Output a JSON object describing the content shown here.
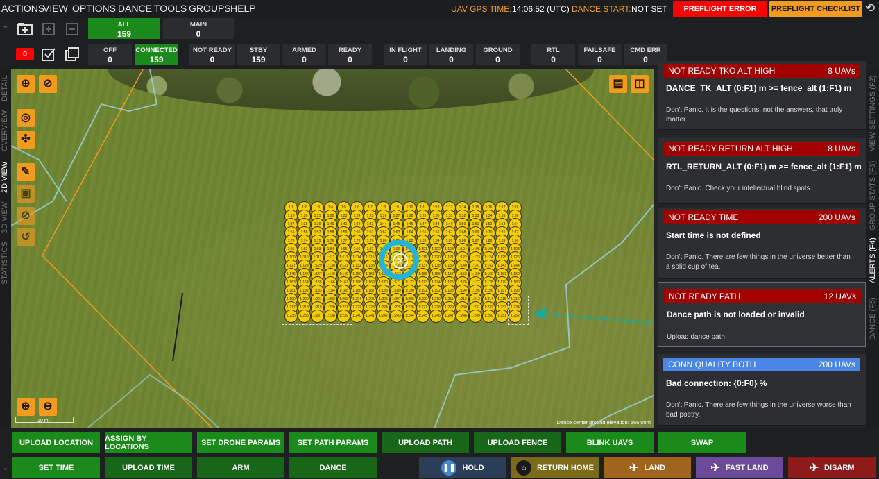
{
  "menu": [
    "ACTIONS",
    "VIEW",
    "OPTIONS",
    "DANCE",
    "TOOLS",
    "GROUPS",
    "HELP"
  ],
  "header": {
    "gps_label": "UAV GPS TIME:",
    "gps_value": "14:06:52 (UTC)",
    "dance_label": "DANCE START:",
    "dance_value": "NOT SET",
    "preflight_error": "PREFLIGHT ERROR",
    "preflight_checklist": "PREFLIGHT CHECKLIST",
    "colors": {
      "error": "#ff0000",
      "checklist": "#f39b1e"
    }
  },
  "groups": [
    {
      "label": "ALL",
      "value": "159"
    },
    {
      "label": "MAIN",
      "value": "0"
    }
  ],
  "alert_counter": "0",
  "stats": [
    {
      "label": "OFF",
      "value": "0"
    },
    {
      "label": "CONNECTED",
      "value": "159"
    },
    {
      "label": "NOT READY",
      "value": "0"
    },
    {
      "label": "STBY",
      "value": "159"
    },
    {
      "label": "ARMED",
      "value": "0"
    },
    {
      "label": "READY",
      "value": "0"
    },
    {
      "label": "IN FLIGHT",
      "value": "0"
    },
    {
      "label": "LANDING",
      "value": "0"
    },
    {
      "label": "GROUND",
      "value": "0"
    },
    {
      "label": "RTL",
      "value": "0"
    },
    {
      "label": "FAILSAFE",
      "value": "0"
    },
    {
      "label": "CMD ERR",
      "value": "0"
    }
  ],
  "left_tabs": [
    "DETAIL",
    "OVERVIEW",
    "2D VIEW",
    "3D VIEW",
    "STATISTICS"
  ],
  "right_tabs": [
    "VIEW SETTINGS (F2)",
    "GROUP STATS (F3)",
    "ALERTS (F4)",
    "DANCE (F5)"
  ],
  "map": {
    "scale_label": "10 m",
    "elevation_text": "Dance center ground elevation: 566.08m",
    "drone_rows": 14,
    "drone_cols": 18
  },
  "alerts": [
    {
      "head": "NOT READY TKO ALT HIGH",
      "count": "8 UAVs",
      "title": "DANCE_TK_ALT (0:F1) m >= fence_alt (1:F1) m",
      "desc": "Don't Panic. It is the questions, not the answers, that truly matter.",
      "color": "#a00000"
    },
    {
      "head": "NOT READY RETURN ALT HIGH",
      "count": "8 UAVs",
      "title": "RTL_RETURN_ALT (0:F1) m >= fence_alt (1:F1) m",
      "desc": "Don't Panic. Check your intellectual blind spots.",
      "color": "#a00000"
    },
    {
      "head": "NOT READY TIME",
      "count": "200 UAVs",
      "title": "Start time is not defined",
      "desc": "Don't Panic. There are few things in the universe better than a solid cup of tea.",
      "color": "#a00000"
    },
    {
      "head": "NOT READY PATH",
      "count": "12 UAVs",
      "title": "Dance path is not loaded or invalid",
      "desc": "Upload dance path",
      "color": "#a00000"
    },
    {
      "head": "CONN QUALITY BOTH",
      "count": "200 UAVs",
      "title": "Bad connection: {0:F0} %",
      "desc": "Don't Panic. There are few things in the universe worse than bad poetry.",
      "color": "#4a86e8"
    }
  ],
  "bottom_row1": [
    "UPLOAD LOCATION",
    "ASSIGN BY LOCATIONS",
    "SET DRONE PARAMS",
    "SET PATH PARAMS",
    "UPLOAD PATH",
    "UPLOAD FENCE",
    "BLINK UAVS",
    "SWAP"
  ],
  "bottom_row2": [
    "SET TIME",
    "UPLOAD TIME",
    "ARM",
    "DANCE"
  ],
  "actions": [
    {
      "label": "HOLD",
      "icon": "pause-icon",
      "color": "#2c3e57"
    },
    {
      "label": "RETURN HOME",
      "icon": "home-icon",
      "color": "#7a6a1a"
    },
    {
      "label": "LAND",
      "icon": "landing-icon",
      "color": "#a0641a"
    },
    {
      "label": "FAST LAND",
      "icon": "fast-landing-icon",
      "color": "#6b4a9a"
    },
    {
      "label": "DISARM",
      "icon": "disarm-icon",
      "color": "#8e1a1a"
    }
  ]
}
